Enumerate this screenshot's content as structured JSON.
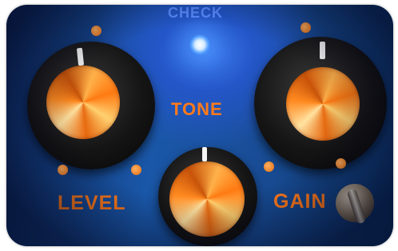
{
  "labels": {
    "check": "CHECK",
    "tone": "TONE",
    "level": "LEVEL",
    "gain": "GAIN"
  },
  "colors": {
    "panel": "#1a57a8",
    "label": "#ff7a1a",
    "led": "#4f9cff"
  }
}
